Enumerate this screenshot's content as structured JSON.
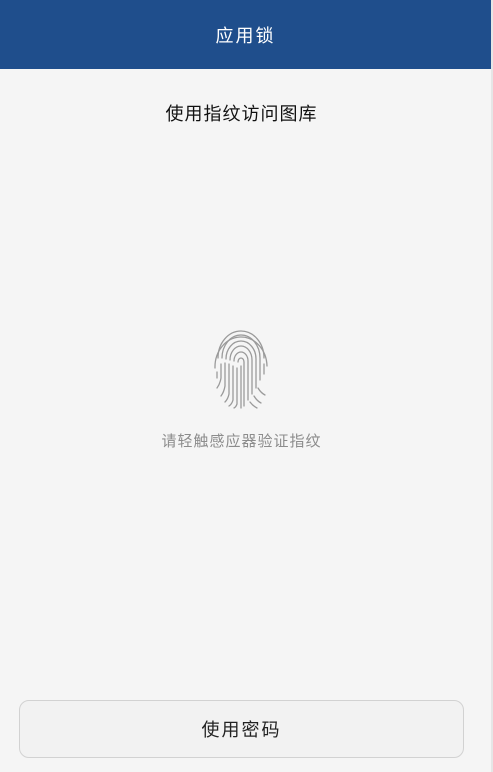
{
  "header": {
    "title": "应用锁"
  },
  "main": {
    "heading": "使用指纹访问图库",
    "fingerprint_icon": "fingerprint-icon",
    "hint": "请轻触感应器验证指纹"
  },
  "footer": {
    "password_button_label": "使用密码"
  },
  "colors": {
    "title_bar": "#1f4e8c",
    "background": "#f5f5f5",
    "hint_text": "#8c8c8c",
    "fingerprint": "#9a9a9a"
  }
}
